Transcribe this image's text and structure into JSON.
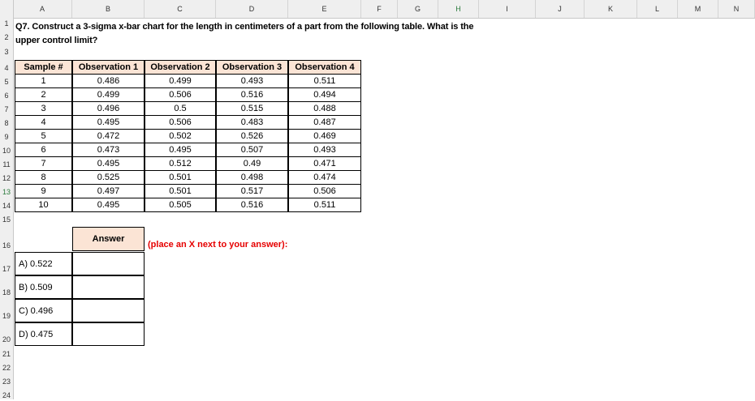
{
  "columns": [
    "A",
    "B",
    "C",
    "D",
    "E",
    "F",
    "G",
    "H",
    "I",
    "J",
    "K",
    "L",
    "M",
    "N"
  ],
  "rows": [
    "1",
    "2",
    "3",
    "4",
    "5",
    "6",
    "7",
    "8",
    "9",
    "10",
    "11",
    "12",
    "13",
    "14",
    "15",
    "16",
    "17",
    "18",
    "19",
    "20",
    "21",
    "22",
    "23",
    "24"
  ],
  "question": {
    "line1": "Q7. Construct a 3-sigma x-bar chart for the length in centimeters of a part from the following table. What is the",
    "line2": "upper control limit?"
  },
  "table": {
    "headers": [
      "Sample #",
      "Observation 1",
      "Observation 2",
      "Observation 3",
      "Observation 4"
    ],
    "rows": [
      [
        "1",
        "0.486",
        "0.499",
        "0.493",
        "0.511"
      ],
      [
        "2",
        "0.499",
        "0.506",
        "0.516",
        "0.494"
      ],
      [
        "3",
        "0.496",
        "0.5",
        "0.515",
        "0.488"
      ],
      [
        "4",
        "0.495",
        "0.506",
        "0.483",
        "0.487"
      ],
      [
        "5",
        "0.472",
        "0.502",
        "0.526",
        "0.469"
      ],
      [
        "6",
        "0.473",
        "0.495",
        "0.507",
        "0.493"
      ],
      [
        "7",
        "0.495",
        "0.512",
        "0.49",
        "0.471"
      ],
      [
        "8",
        "0.525",
        "0.501",
        "0.498",
        "0.474"
      ],
      [
        "9",
        "0.497",
        "0.501",
        "0.517",
        "0.506"
      ],
      [
        "10",
        "0.495",
        "0.505",
        "0.516",
        "0.511"
      ]
    ]
  },
  "answer": {
    "header": "Answer",
    "note": "(place an X next to your answer):",
    "options": [
      "A) 0.522",
      "B) 0.509",
      "C) 0.496",
      "D) 0.475"
    ]
  }
}
